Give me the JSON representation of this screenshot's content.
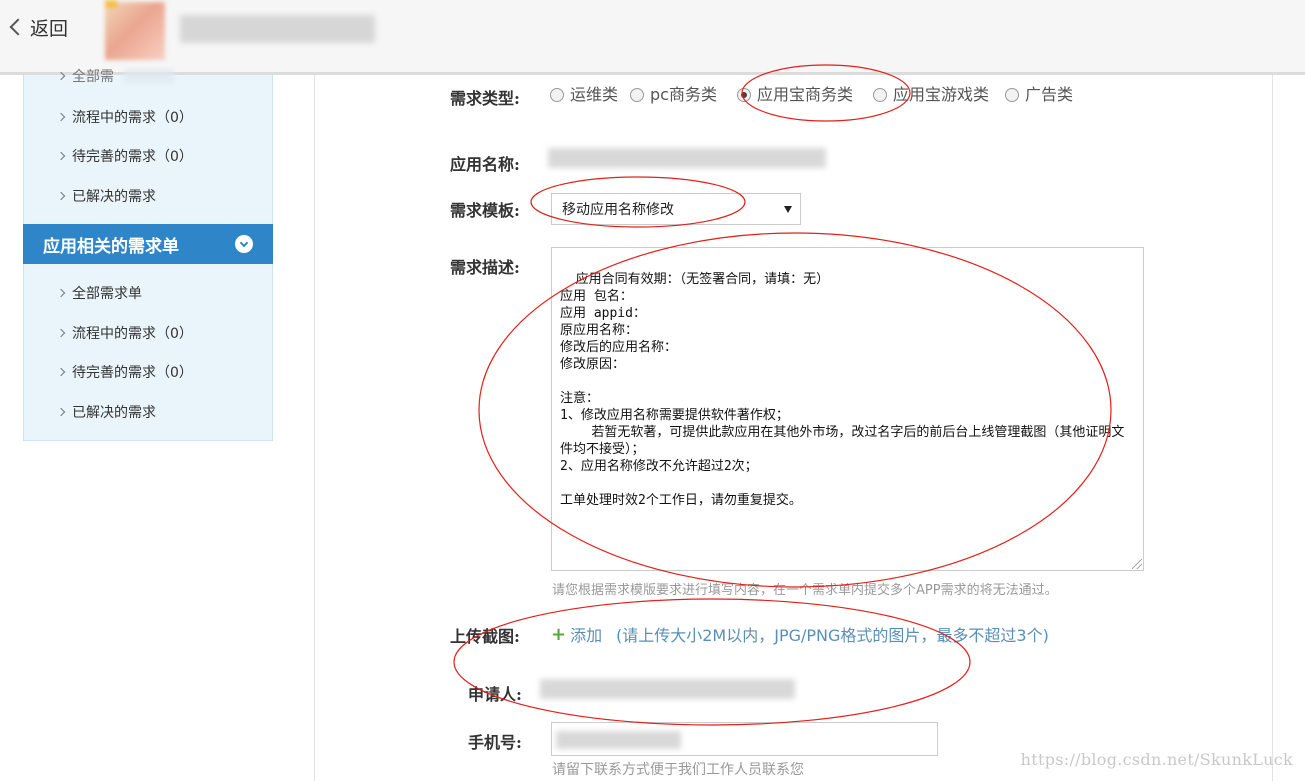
{
  "header": {
    "back_label": "返回"
  },
  "sidebar": {
    "section1_items": [
      {
        "label": "全部需"
      },
      {
        "label": "流程中的需求（0）"
      },
      {
        "label": "待完善的需求（0）"
      },
      {
        "label": "已解决的需求"
      }
    ],
    "section2_title": "应用相关的需求单",
    "section2_items": [
      {
        "label": "全部需求单"
      },
      {
        "label": "流程中的需求（0）"
      },
      {
        "label": "待完善的需求（0）"
      },
      {
        "label": "已解决的需求"
      }
    ]
  },
  "form": {
    "type_label": "需求类型:",
    "type_options": [
      {
        "label": "运维类",
        "selected": false
      },
      {
        "label": "pc商务类",
        "selected": false
      },
      {
        "label": "应用宝商务类",
        "selected": true
      },
      {
        "label": "应用宝游戏类",
        "selected": false
      },
      {
        "label": "广告类",
        "selected": false
      }
    ],
    "app_name_label": "应用名称:",
    "template_label": "需求模板:",
    "template_value": "移动应用名称修改",
    "desc_label": "需求描述:",
    "desc_text": "应用合同有效期：（无签署合同，请填：无）\n应用 包名：\n应用 appid：\n原应用名称：\n修改后的应用名称：\n修改原因：\n\n注意：\n1、修改应用名称需要提供软件著作权；\n    若暂无软著，可提供此款应用在其他外市场，改过名字后的前后台上线管理截图（其他证明文件均不接受）；\n2、应用名称修改不允许超过2次；\n\n工单处理时效2个工作日，请勿重复提交。",
    "desc_hint": "请您根据需求模版要求进行填写内容，在一个需求单内提交多个APP需求的将无法通过。",
    "upload_label": "上传截图:",
    "upload_add": "添加",
    "upload_hint": "(请上传大小2M以内，JPG/PNG格式的图片，最多不超过3个)",
    "applicant_label": "申请人:",
    "phone_label": "手机号:",
    "phone_hint": "请留下联系方式便于我们工作人员联系您"
  },
  "watermark": "https://blog.csdn.net/SkunkLuck",
  "colors": {
    "sidebar_header": "#2e86c9",
    "sidebar_bg": "#eaf4fb",
    "annotation_ellipse": "#e0201b",
    "link": "#5a8fb5"
  }
}
